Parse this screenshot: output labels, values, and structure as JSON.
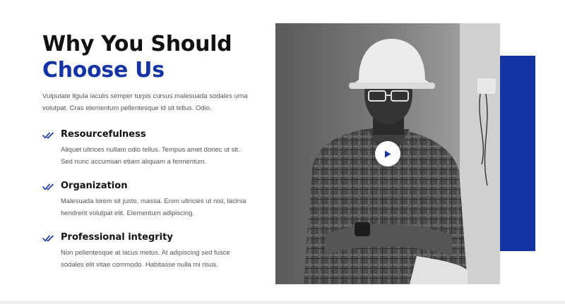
{
  "heading": {
    "line1": "Why You Should",
    "line2": "Choose Us"
  },
  "intro": "Vulputate ligula iaculis semper turpis cursus malesuada sodales urna volutpat. Cras elementum pellentesque id sit tellus. Odio.",
  "features": [
    {
      "icon": "double-check-icon",
      "title": "Resourcefulness",
      "description": "Aliquet ultrices nullam odio tellus. Tempus amet donec ut sit. Sed nunc accumsan etiam aliquam a fermentum."
    },
    {
      "icon": "double-check-icon",
      "title": "Organization",
      "description": "Malesuada lorem sit justo, massa. Enim ultricies ut nisi, lacinia hendrerit volutpat elit. Elementum adipiscing."
    },
    {
      "icon": "double-check-icon",
      "title": "Professional integrity",
      "description": "Non pellentesque at lacus metus. At adipiscing sed fusce sodales elit vitae commodo. Habitasse nulla mi risus."
    }
  ],
  "media": {
    "photo": "construction-worker-photo",
    "play_icon": "play-icon"
  },
  "colors": {
    "accent": "#1434a4",
    "heading": "#111111",
    "body_text": "#555555"
  }
}
